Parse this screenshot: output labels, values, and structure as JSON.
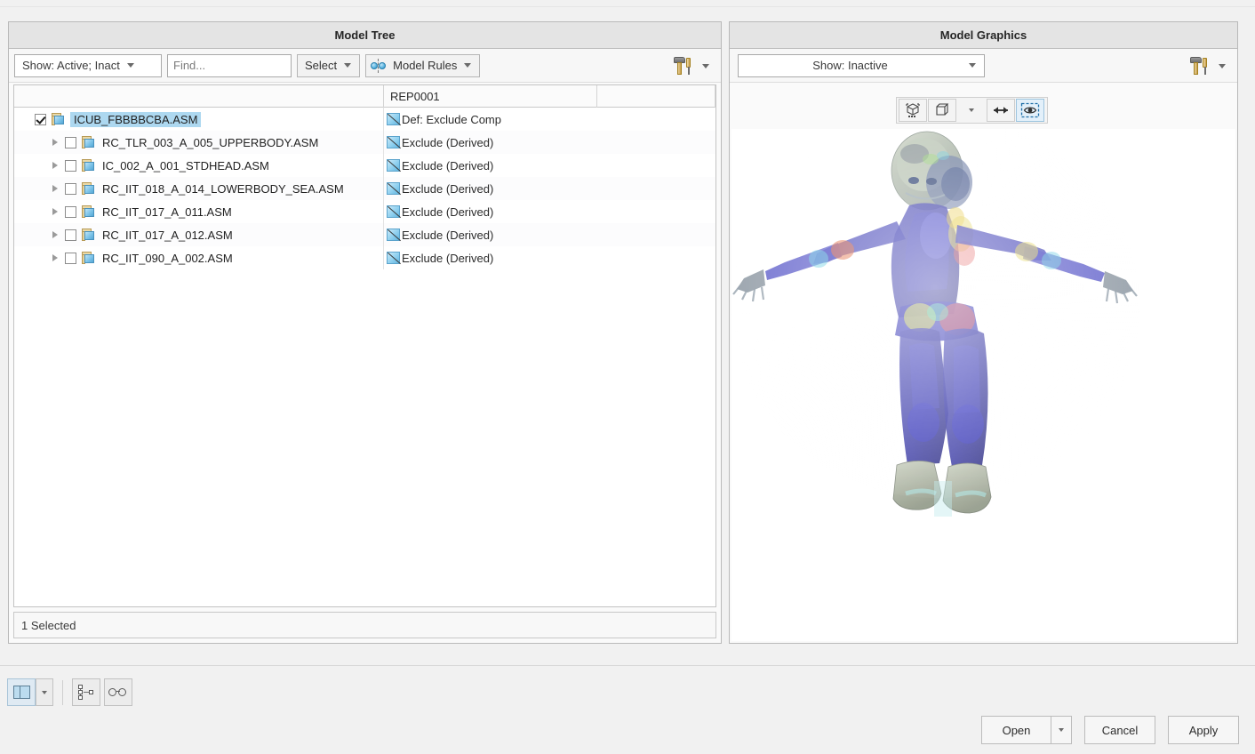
{
  "tree_panel": {
    "title": "Model Tree",
    "toolbar": {
      "show_filter_value": "Show: Active; Inact",
      "find_placeholder": "Find...",
      "find_value": "",
      "select_label": "Select",
      "model_rules_label": "Model Rules",
      "tools_icon": "hammer-screwdriver-icon"
    },
    "columns": [
      "",
      "REP0001",
      ""
    ],
    "rows": [
      {
        "name": "ICUB_FBBBBCBA.ASM",
        "rep": "Def: Exclude Comp",
        "checked": true,
        "selected": true,
        "expandable": false,
        "indent": 0
      },
      {
        "name": "RC_TLR_003_A_005_UPPERBODY.ASM",
        "rep": "Exclude (Derived)",
        "checked": false,
        "selected": false,
        "expandable": true,
        "indent": 1
      },
      {
        "name": "IC_002_A_001_STDHEAD.ASM",
        "rep": "Exclude (Derived)",
        "checked": false,
        "selected": false,
        "expandable": true,
        "indent": 1
      },
      {
        "name": "RC_IIT_018_A_014_LOWERBODY_SEA.ASM",
        "rep": "Exclude (Derived)",
        "checked": false,
        "selected": false,
        "expandable": true,
        "indent": 1
      },
      {
        "name": "RC_IIT_017_A_011.ASM",
        "rep": "Exclude (Derived)",
        "checked": false,
        "selected": false,
        "expandable": true,
        "indent": 1
      },
      {
        "name": "RC_IIT_017_A_012.ASM",
        "rep": "Exclude (Derived)",
        "checked": false,
        "selected": false,
        "expandable": true,
        "indent": 1
      },
      {
        "name": "RC_IIT_090_A_002.ASM",
        "rep": "Exclude (Derived)",
        "checked": false,
        "selected": false,
        "expandable": true,
        "indent": 1
      }
    ],
    "status": "1 Selected"
  },
  "graphics_panel": {
    "title": "Model Graphics",
    "show_filter_value": "Show: Inactive",
    "tools_icon": "hammer-screwdriver-icon",
    "view_buttons": [
      {
        "icon": "refit-model-icon",
        "active": false
      },
      {
        "icon": "display-style-cube-icon",
        "active": false
      },
      {
        "icon": "display-style-dropdown-caret",
        "active": false
      },
      {
        "icon": "double-arrow-icon",
        "active": false
      },
      {
        "icon": "eye-visibility-icon",
        "active": true
      }
    ],
    "model_name": "iCub humanoid robot assembly"
  },
  "bottom_toolbar": {
    "buttons": [
      {
        "icon": "split-pane-layout-icon",
        "active": true
      },
      {
        "icon": "layout-dropdown-caret",
        "active": false
      },
      {
        "icon": "hierarchy-tree-icon",
        "active": false
      },
      {
        "icon": "glasses-preview-icon",
        "active": false
      }
    ]
  },
  "actions": {
    "open_label": "Open",
    "open_has_dropdown": true,
    "cancel_label": "Cancel",
    "apply_label": "Apply"
  },
  "colors": {
    "selection_highlight": "#add8f0",
    "panel_header_bg": "#e4e4e4",
    "window_bg": "#f1f1f1",
    "active_button_bg": "#e3f0fa"
  }
}
